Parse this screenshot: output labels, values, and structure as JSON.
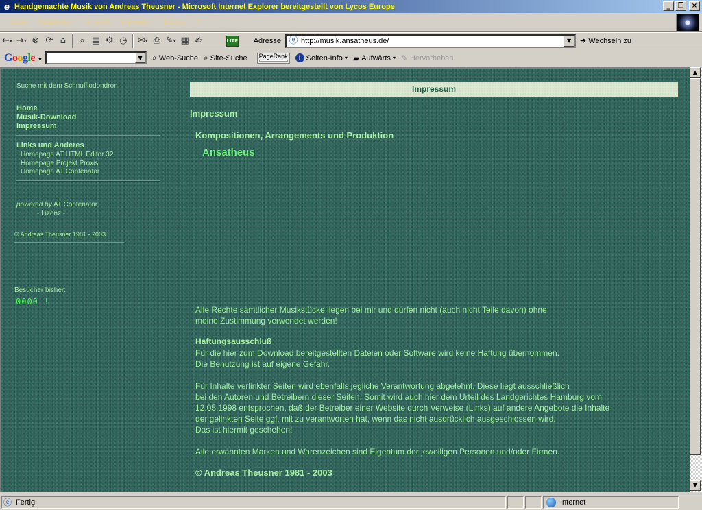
{
  "window": {
    "title": "Handgemachte Musik von Andreas Theusner - Microsoft Internet Explorer bereitgestellt von Lycos Europe",
    "buttons": {
      "minimize": "_",
      "maximize": "❐",
      "close": "×"
    }
  },
  "menu": [
    "Datei",
    "Bearbeiten",
    "Ansicht",
    "Favoriten",
    "Extras",
    "?"
  ],
  "toolbar": {
    "lite_badge": "LITE",
    "address_label": "Adresse",
    "address_value": "http://musik.ansatheus.de/",
    "go_label": "Wechseln zu"
  },
  "google": {
    "logo": [
      "G",
      "o",
      "o",
      "g",
      "l",
      "e"
    ],
    "web_search": "Web-Suche",
    "site_search": "Site-Suche",
    "pagerank": "PageRank",
    "page_info": "Seiten-Info",
    "up": "Aufwärts",
    "highlight": "Hervorheben"
  },
  "page": {
    "search_link": "Suche mit dem Schnufflodondron",
    "nav": [
      "Home",
      "Musik-Download",
      "Impressum"
    ],
    "links_heading": "Links und Anderes",
    "links": [
      "Homepage AT HTML Editor 32",
      "Homepage Projekt Proxis",
      "Homepage AT Contenator"
    ],
    "powered_by": "powered by",
    "powered_name": "AT Contenator",
    "license": "- Lizenz -",
    "copyright_small": "© Andreas Theusner 1981 - 2003",
    "visitors_label": "Besucher bisher:",
    "visitor_count": "0000 !",
    "heading_bar": "Impressum",
    "section_title": "Impressum",
    "subtitle": "Kompositionen, Arrangements und Produktion",
    "artist": "Ansatheus",
    "rights_lines": [
      "Alle Rechte sämtlicher Musikstücke liegen bei mir und dürfen nicht (auch nicht Teile davon) ohne",
      "meine Zustimmung verwendet werden!"
    ],
    "disclaimer_title": "Haftungsausschluß",
    "disclaimer_lines_1": [
      "Für die hier zum Download bereitgestellten Dateien oder Software wird keine Haftung übernommen.",
      "Die Benutzung ist auf eigene Gefahr."
    ],
    "disclaimer_lines_2": [
      "Für Inhalte verlinkter Seiten wird ebenfalls jegliche Verantwortung abgelehnt. Diese liegt ausschließlich",
      "bei den Autoren und Betreibern dieser Seiten. Somit wird auch hier dem Urteil des Landgerichtes Hamburg vom",
      "12.05.1998 entsprochen, daß der Betreiber einer Website durch Verweise (Links) auf andere Angebote die Inhalte",
      "der gelinkten Seite ggf. mit zu verantworten hat, wenn das nicht ausdrücklich ausgeschlossen wird.",
      "Das ist hiermit geschehen!"
    ],
    "trademark_line": "Alle erwähnten Marken und Warenzeichen sind Eigentum der jeweiligen Personen und/oder Firmen.",
    "copyright_main": "© Andreas Theusner 1981 - 2003"
  },
  "status": {
    "text": "Fertig",
    "zone": "Internet"
  }
}
